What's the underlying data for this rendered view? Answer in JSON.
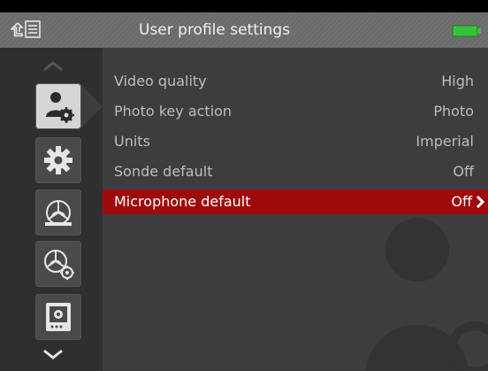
{
  "header": {
    "title": "User profile settings",
    "battery_color": "#37c23a"
  },
  "sidebar": {
    "items": [
      {
        "name": "user-profile-icon",
        "active": true
      },
      {
        "name": "settings-icon",
        "active": false
      },
      {
        "name": "sonde-icon",
        "active": false
      },
      {
        "name": "sonde-settings-icon",
        "active": false
      },
      {
        "name": "display-settings-icon",
        "active": false
      }
    ]
  },
  "settings": {
    "rows": [
      {
        "label": "Video quality",
        "value": "High"
      },
      {
        "label": "Photo key action",
        "value": "Photo"
      },
      {
        "label": "Units",
        "value": "Imperial"
      },
      {
        "label": "Sonde default",
        "value": "Off"
      },
      {
        "label": "Microphone default",
        "value": "Off"
      }
    ],
    "selected_index": 4,
    "selected_color": "#9e0a0a"
  }
}
